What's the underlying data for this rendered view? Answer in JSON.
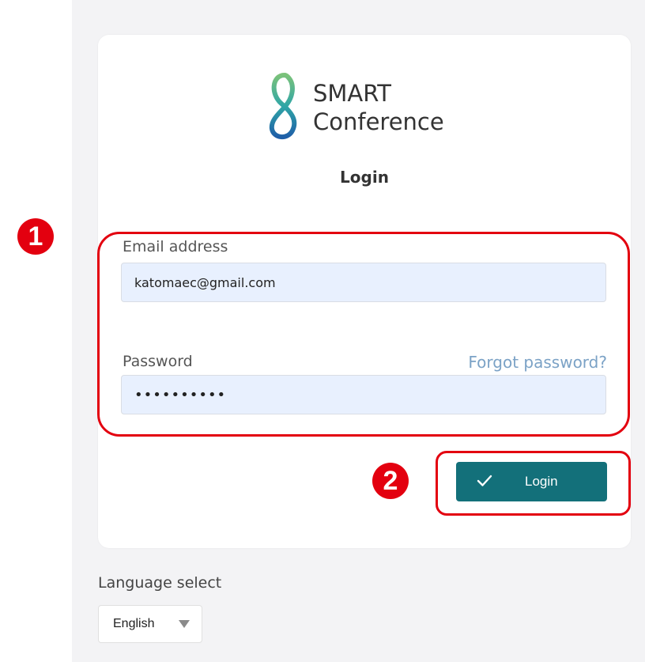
{
  "logo": {
    "line1": "SMART",
    "line2": "Conference",
    "icon": "infinity-8-icon"
  },
  "form": {
    "title": "Login",
    "email_label": "Email address",
    "email_value": "katomaec@gmail.com",
    "password_label": "Password",
    "password_value": "••••••••••",
    "forgot_link": "Forgot password?",
    "login_button": "Login",
    "login_icon": "check-icon"
  },
  "language": {
    "label": "Language select",
    "selected": "English",
    "caret_icon": "caret-down-icon"
  },
  "annotations": [
    {
      "number": "1"
    },
    {
      "number": "2"
    }
  ],
  "colors": {
    "accent": "#13707a",
    "annotation": "#e3000f",
    "link": "#7ba2c6",
    "input_bg": "#e8f0fe"
  }
}
